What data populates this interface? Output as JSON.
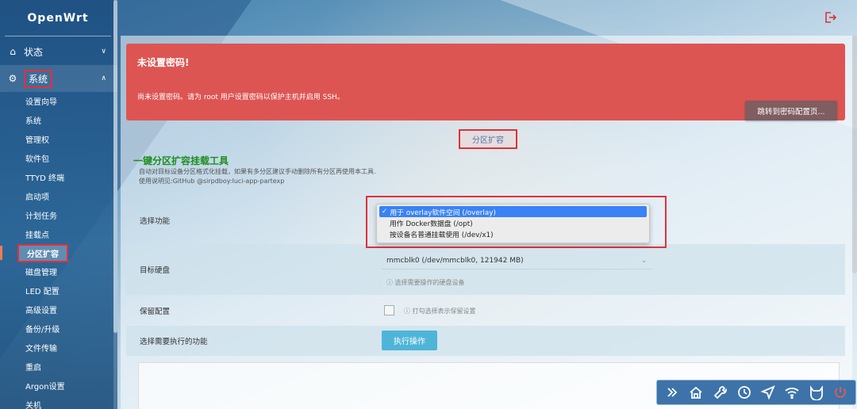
{
  "brand": "OpenWrt",
  "nav": {
    "status": {
      "label": "状态",
      "icon": "home-icon"
    },
    "system": {
      "label": "系统",
      "icon": "gear-icon"
    },
    "system_items": [
      "设置向导",
      "系统",
      "管理权",
      "软件包",
      "TTYD 终端",
      "启动项",
      "计划任务",
      "挂载点",
      "分区扩容",
      "磁盘管理",
      "LED 配置",
      "高级设置",
      "备份/升级",
      "文件传输",
      "重启",
      "Argon设置",
      "关机"
    ],
    "current_item": "分区扩容"
  },
  "alert": {
    "title": "未设置密码!",
    "message": "尚未设置密码。请为 root 用户设置密码以保护主机并启用 SSH。",
    "button": "跳转到密码配置页..."
  },
  "tab": {
    "label": "分区扩容"
  },
  "tool": {
    "title": "一键分区扩容挂载工具",
    "desc_line1": "自动对目标设备分区格式化挂载，如果有多分区建议手动删除所有分区再使用本工具.",
    "desc_line2": "使用说明见:GitHub @sirpdboy:luci-app-partexp"
  },
  "form": {
    "function_label": "选择功能",
    "function_options": [
      "用于 overlay软件空间 (/overlay)",
      "用作 Docker数据盘 (/opt)",
      "按设备名普通挂载使用 (/dev/x1)"
    ],
    "function_selected_mark": "✓",
    "disk_label": "目标硬盘",
    "disk_value": "mmcblk0 (/dev/mmcblk0, 121942 MB)",
    "disk_hint": "ⓘ 选择需要操作的硬盘设备",
    "keep_label": "保留配置",
    "keep_hint": "ⓘ 打勾选择表示保留设置",
    "exec_label": "选择需要执行的功能",
    "exec_button": "执行操作"
  },
  "colors": {
    "alert_bg": "#dd5553",
    "highlight": "#e0313a",
    "title_green": "#1f8d1f",
    "button_blue": "#4fb5d8"
  }
}
